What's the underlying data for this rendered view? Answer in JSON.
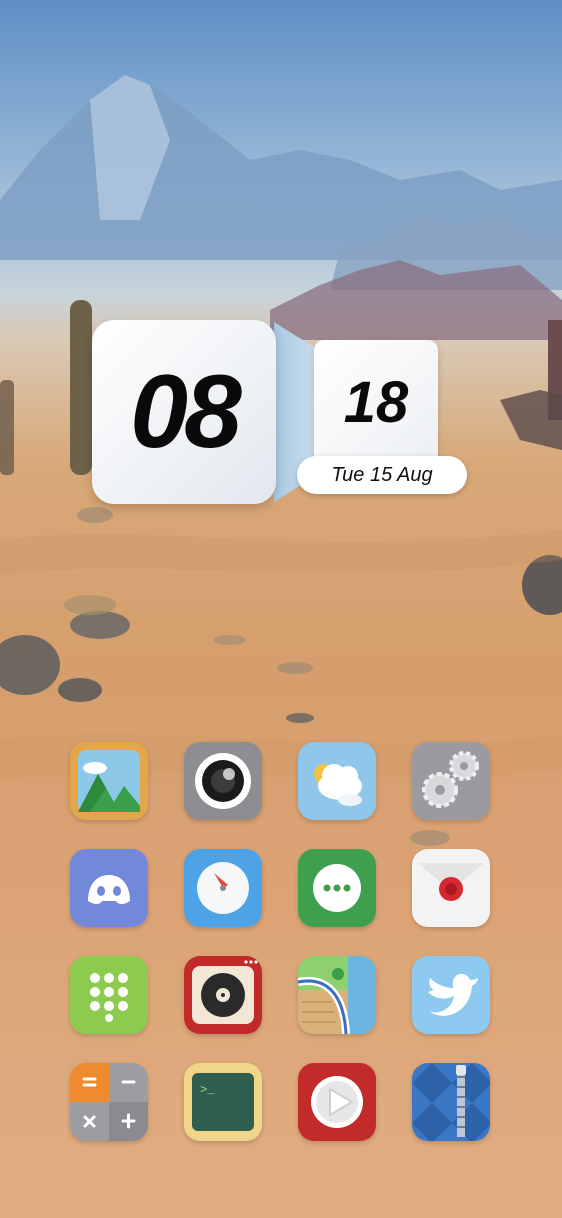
{
  "clock_widget": {
    "hour": "08",
    "minute": "18",
    "date": "Tue 15 Aug"
  },
  "apps": [
    {
      "icon": "photos-mountain-icon"
    },
    {
      "icon": "camera-lens-icon"
    },
    {
      "icon": "weather-cloud-icon"
    },
    {
      "icon": "settings-gears-icon"
    },
    {
      "icon": "discord-icon"
    },
    {
      "icon": "compass-browser-icon"
    },
    {
      "icon": "messages-bubble-icon"
    },
    {
      "icon": "mail-envelope-icon"
    },
    {
      "icon": "dialer-keypad-icon"
    },
    {
      "icon": "music-record-icon"
    },
    {
      "icon": "maps-icon"
    },
    {
      "icon": "twitter-bird-icon"
    },
    {
      "icon": "calculator-icon"
    },
    {
      "icon": "terminal-icon"
    },
    {
      "icon": "video-player-icon"
    },
    {
      "icon": "archive-zipper-icon"
    }
  ],
  "colors": {
    "sky_top": "#5f8fc6",
    "sand": "#d69e6c",
    "widget_side": "#a9c9e2"
  }
}
